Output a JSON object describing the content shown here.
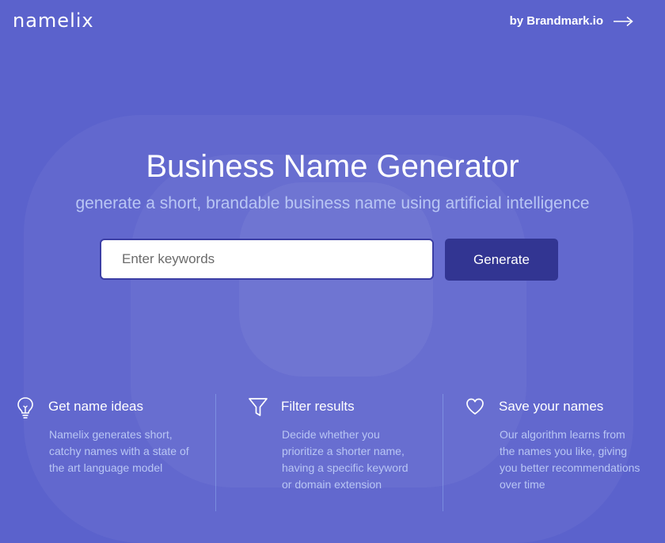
{
  "header": {
    "logo": "namelix",
    "by_link": "by Brandmark.io",
    "arrow_icon": "arrow-right-icon"
  },
  "hero": {
    "title": "Business Name Generator",
    "subtitle": "generate a short, brandable business name using artificial intelligence",
    "search": {
      "placeholder": "Enter keywords",
      "value": ""
    },
    "generate_label": "Generate"
  },
  "features": [
    {
      "icon": "lightbulb-icon",
      "title": "Get name ideas",
      "description": "Namelix generates short, catchy names with a state of the art language model"
    },
    {
      "icon": "filter-icon",
      "title": "Filter results",
      "description": "Decide whether you prioritize a shorter name, having a specific keyword or domain extension"
    },
    {
      "icon": "heart-icon",
      "title": "Save your names",
      "description": "Our algorithm learns from the names you like, giving you better recommendations over time"
    }
  ],
  "colors": {
    "background": "#5b62cc",
    "button": "#323592",
    "subtitle": "#b9c6f4"
  }
}
